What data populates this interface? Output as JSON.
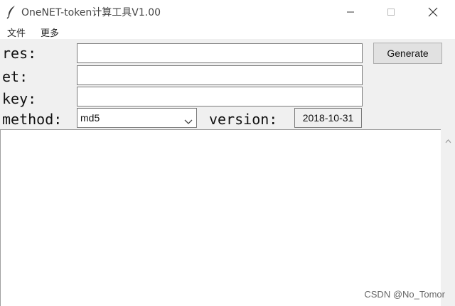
{
  "window": {
    "title": "OneNET-token计算工具V1.00",
    "icon": "feather-icon",
    "controls": [
      "minimize-icon",
      "maximize-icon",
      "close-icon"
    ]
  },
  "menu": {
    "items": [
      "文件",
      "更多"
    ]
  },
  "form": {
    "res_label": "res:",
    "et_label": "et:",
    "key_label": "key:",
    "method_label": "method:",
    "version_label": "version:",
    "res_value": "",
    "et_value": "",
    "key_value": "",
    "method_selected": "md5",
    "version_value": "2018-10-31",
    "generate_label": "Generate"
  },
  "output": {
    "text": ""
  },
  "watermark": "CSDN @No_Tomor"
}
